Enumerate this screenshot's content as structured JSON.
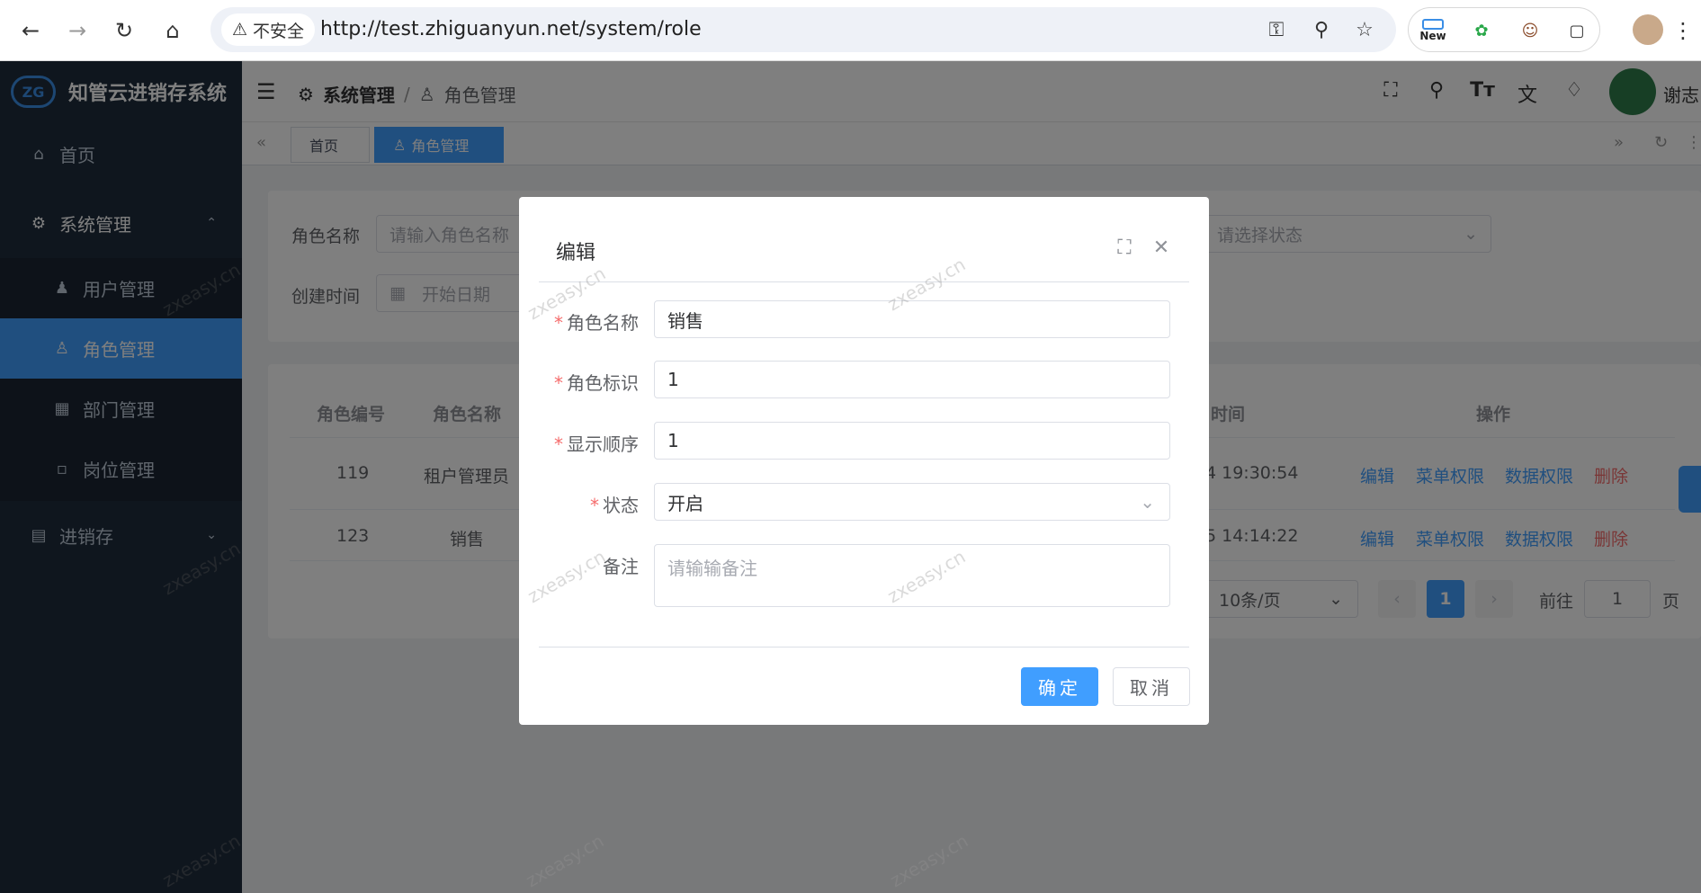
{
  "browser": {
    "insecure_label": "不安全",
    "url": "http://test.zhiguanyun.net/system/role",
    "ext_new_label": "New"
  },
  "app": {
    "logo_mark": "ZG",
    "title": "知管云进销存系统",
    "accent_color": "#409eff",
    "sidebar_color": "#1f2d3d"
  },
  "sidebar": {
    "home": "首页",
    "system": "系统管理",
    "users": "用户管理",
    "roles": "角色管理",
    "depts": "部门管理",
    "posts": "岗位管理",
    "inventory": "进销存"
  },
  "header": {
    "breadcrumb_parent": "系统管理",
    "breadcrumb_current": "角色管理",
    "user_name": "谢志"
  },
  "tags": {
    "home": "首页",
    "roles": "角色管理"
  },
  "search": {
    "role_name_label": "角色名称",
    "role_name_placeholder": "请输入角色名称",
    "status_placeholder": "请选择状态",
    "created_label": "创建时间",
    "start_date_placeholder": "开始日期"
  },
  "table": {
    "headers": {
      "id": "角色编号",
      "name": "角色名称",
      "time": "时间",
      "ops": "操作"
    },
    "rows": [
      {
        "id": "119",
        "name": "租户管理员",
        "time": "4 19:30:54"
      },
      {
        "id": "123",
        "name": "销售",
        "time": "5 14:14:22"
      }
    ],
    "ops": {
      "edit": "编辑",
      "menu_perm": "菜单权限",
      "data_perm": "数据权限",
      "delete": "删除"
    }
  },
  "pagination": {
    "page_size": "10条/页",
    "current_page": "1",
    "goto_label": "前往",
    "goto_value": "1",
    "page_suffix": "页"
  },
  "dialog": {
    "title": "编辑",
    "fields": {
      "role_name_label": "角色名称",
      "role_name_value": "销售",
      "role_key_label": "角色标识",
      "role_key_value": "1",
      "order_label": "显示顺序",
      "order_value": "1",
      "status_label": "状态",
      "status_value": "开启",
      "remark_label": "备注",
      "remark_placeholder": "请输输备注"
    },
    "confirm": "确定",
    "cancel": "取消"
  },
  "watermark": "zxeasy.cn"
}
